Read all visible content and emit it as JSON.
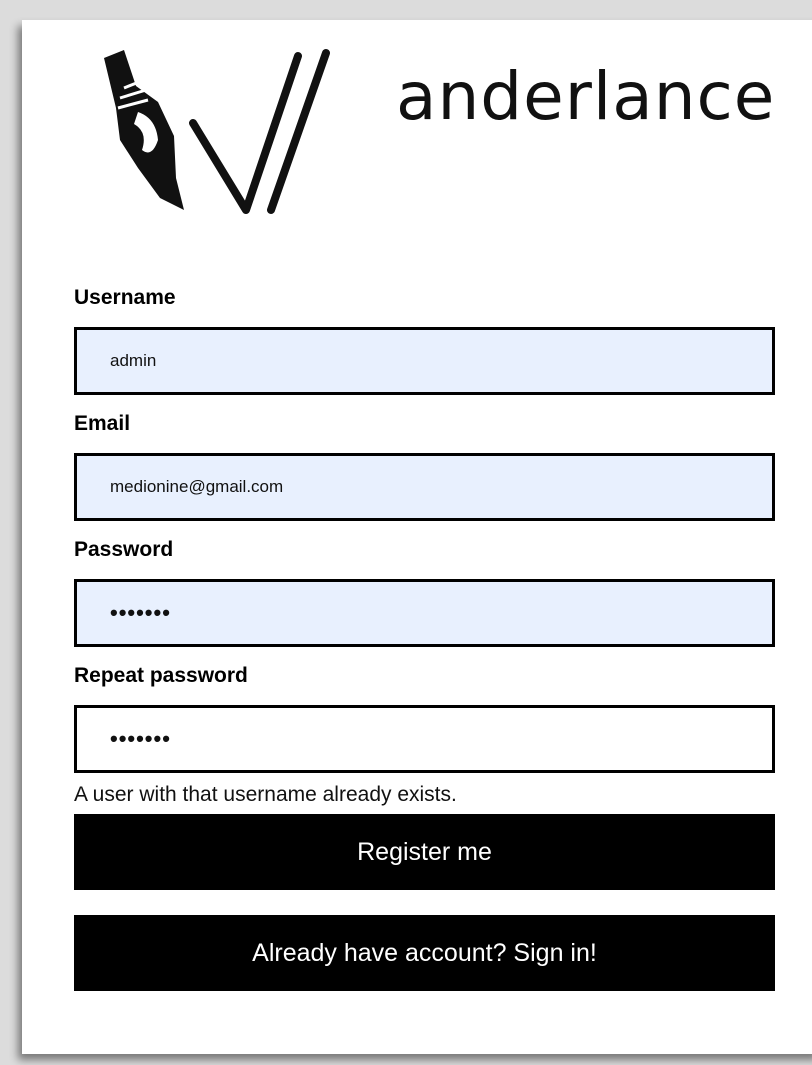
{
  "brand": {
    "logo_text": "anderlance",
    "logo_icon": "pen-nib-w-logo"
  },
  "form": {
    "username": {
      "label": "Username",
      "value": "admin"
    },
    "email": {
      "label": "Email",
      "value": "medionine@gmail.com"
    },
    "password": {
      "label": "Password",
      "value": "•••••••"
    },
    "repeat_password": {
      "label": "Repeat password",
      "value": "•••••••"
    },
    "error_message": "A user with that username already exists.",
    "register_button": "Register me",
    "signin_button": "Already have account? Sign in!"
  },
  "colors": {
    "autofill_background": "#e8f0fe",
    "button_background": "#000000",
    "button_text": "#ffffff"
  }
}
